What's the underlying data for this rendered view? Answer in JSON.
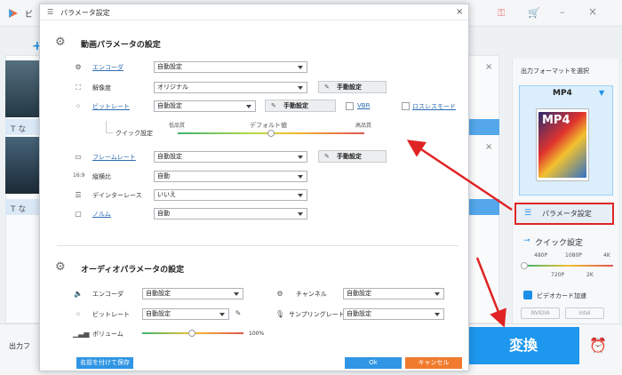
{
  "app": {
    "title": "ビ",
    "add_symbol": "+",
    "file_name_prefix_1": "T な",
    "file_name_prefix_2": "T な",
    "output_folder_label": "出力フ",
    "convert_label": "変換",
    "format_panel": {
      "select_label": "出力フォーマットを選択",
      "format_name": "MP4",
      "icon_text": "MP4",
      "param_settings_label": "パラメータ設定",
      "quick_settings_label": "クイック設定",
      "ticks_top": [
        "480P",
        "1080P",
        "4K"
      ],
      "ticks_bottom": [
        "720P",
        "2K"
      ],
      "gpu_label": "ビデオカード加速",
      "gpu_badge_1": "NVIDIA",
      "gpu_badge_2": "intel"
    }
  },
  "dialog": {
    "title": "パラメータ設定",
    "video": {
      "section_title": "動画パラメータの設定",
      "encoder_label": "エンコーダ",
      "encoder_value": "自動設定",
      "resolution_label": "解像度",
      "resolution_value": "オリジナル",
      "resolution_manual": "手動設定",
      "bitrate_label": "ビットレート",
      "bitrate_value": "自動設定",
      "bitrate_manual": "手動設定",
      "vbr_label": "VBR",
      "lossless_label": "ロスレスモード",
      "quick_label": "クイック設定",
      "quality_low": "低品質",
      "quality_default": "デフォルト値",
      "quality_high": "高品質",
      "framerate_label": "フレームレート",
      "framerate_value": "自動設定",
      "framerate_manual": "手動設定",
      "aspect_label": "縦横比",
      "aspect_value": "自動",
      "deinterlace_label": "デインターレース",
      "deinterlace_value": "いいえ",
      "norm_label": "ノルム",
      "norm_value": "自動"
    },
    "audio": {
      "section_title": "オーディオパラメータの設定",
      "encoder_label": "エンコーダ",
      "encoder_value": "自動設定",
      "channel_label": "チャンネル",
      "channel_value": "自動設定",
      "bitrate_label": "ビットレート",
      "bitrate_value": "自動設定",
      "samplerate_label": "サンプリングレート",
      "samplerate_value": "自動設定",
      "volume_label": "ボリューム",
      "volume_value": "100%",
      "volume_level": 0.5
    },
    "footer": {
      "save_as_label": "名前を付けて保存",
      "ok_label": "Ok",
      "cancel_label": "キャンセル"
    }
  },
  "colors": {
    "accent_blue": "#1e97ee",
    "highlight_red": "#e02424",
    "cancel_orange": "#f07b2e"
  }
}
